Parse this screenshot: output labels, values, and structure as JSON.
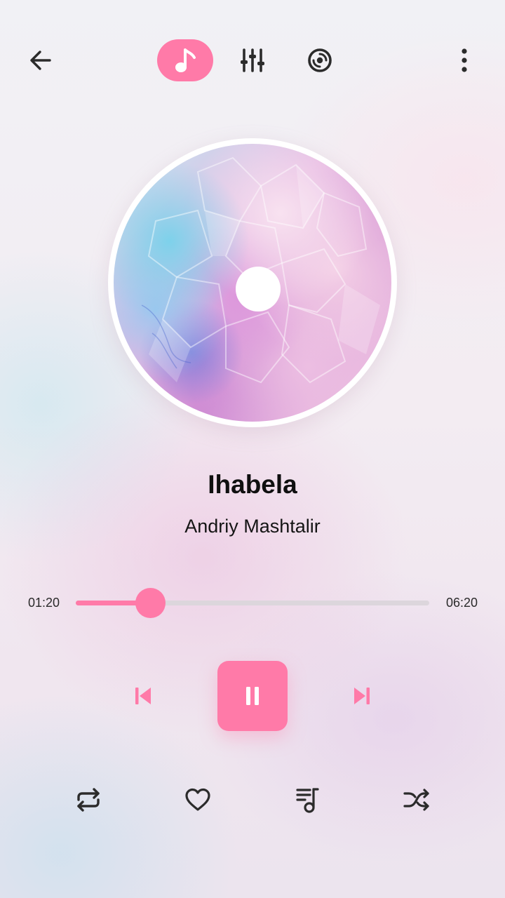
{
  "header": {
    "tabs": [
      {
        "icon": "music-note-icon",
        "active": true
      },
      {
        "icon": "equalizer-icon",
        "active": false
      },
      {
        "icon": "disc-icon",
        "active": false
      }
    ],
    "back_icon": "back-arrow-icon",
    "more_icon": "more-vertical-icon"
  },
  "track": {
    "title": "Ihabela",
    "artist": "Andriy Mashtalir"
  },
  "progress": {
    "elapsed": "01:20",
    "total": "06:20",
    "fraction": 0.21
  },
  "controls": {
    "previous_icon": "skip-previous-icon",
    "play_state_icon": "pause-icon",
    "next_icon": "skip-next-icon"
  },
  "actions": [
    "repeat-icon",
    "heart-icon",
    "queue-music-icon",
    "shuffle-icon"
  ],
  "colors": {
    "accent": "#ff7aa8",
    "text": "#101010",
    "track_bg": "#dcd6dc"
  }
}
